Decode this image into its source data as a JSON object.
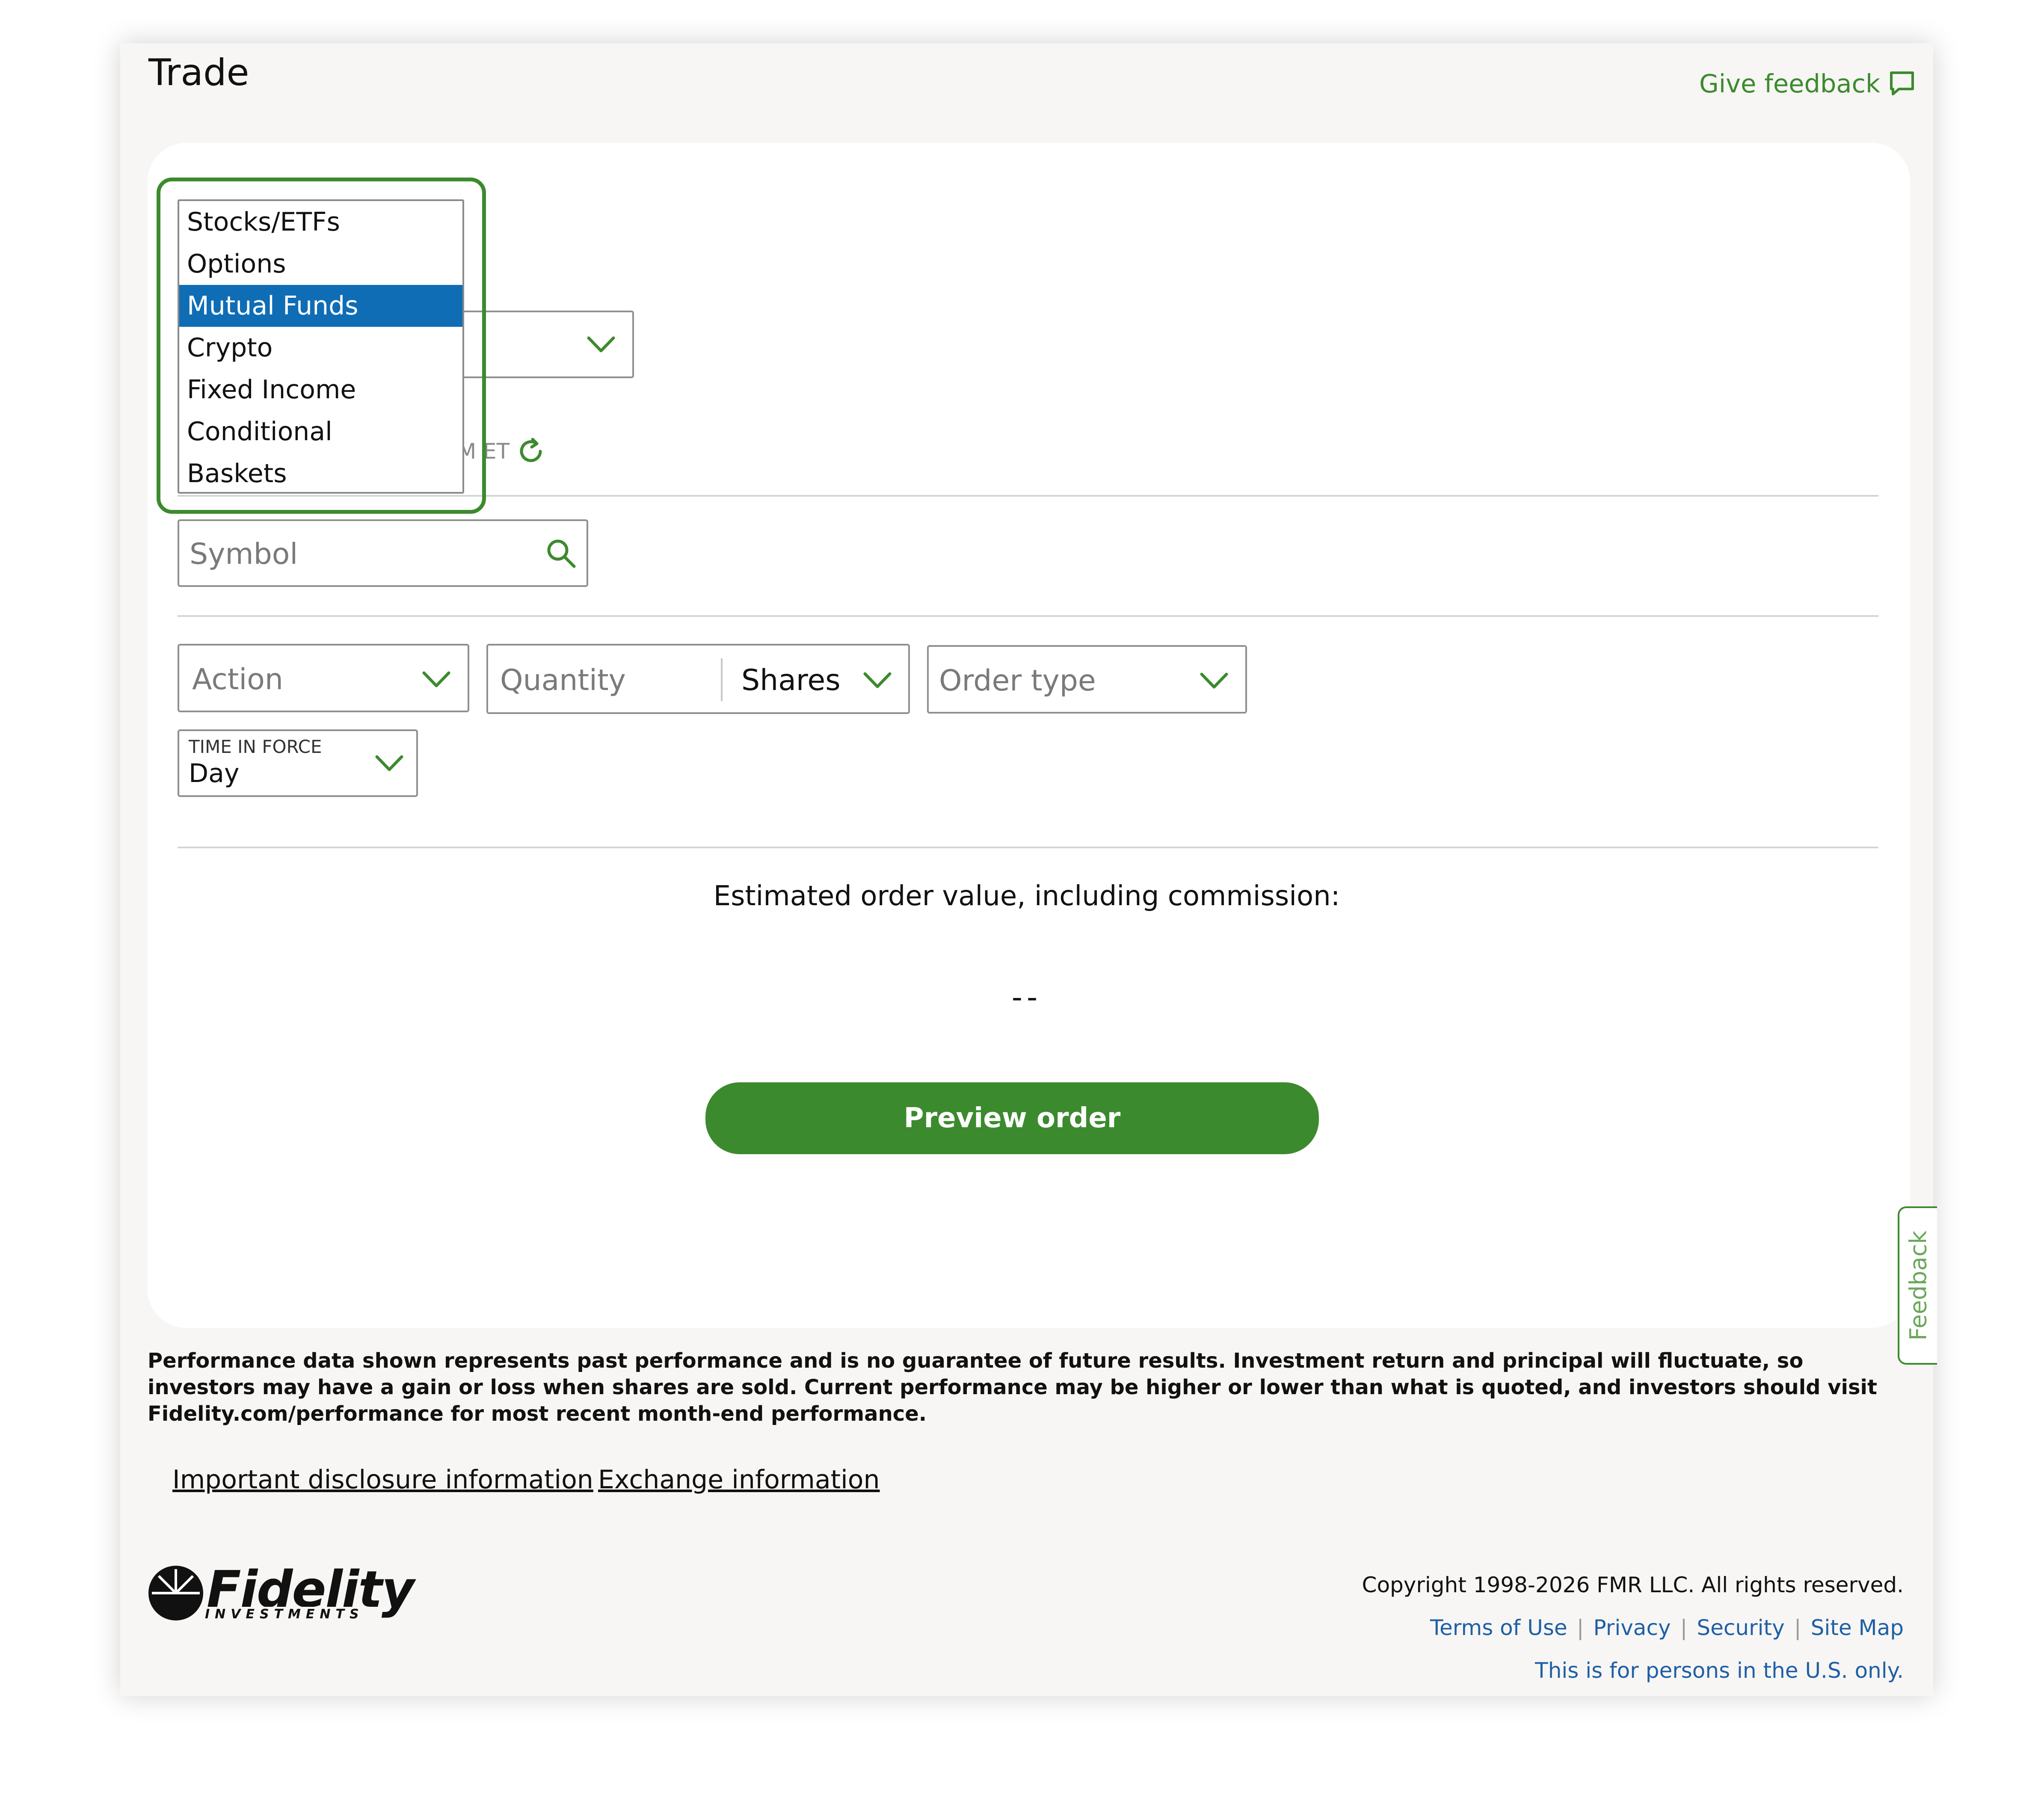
{
  "header": {
    "title": "Trade",
    "give_feedback_label": "Give feedback"
  },
  "trade_type_menu": {
    "options": [
      "Stocks/ETFs",
      "Options",
      "Mutual Funds",
      "Crypto",
      "Fixed Income",
      "Conditional",
      "Baskets"
    ],
    "selected": "Mutual Funds"
  },
  "account_select": {
    "partial_time_text": "M ET"
  },
  "symbol": {
    "placeholder": "Symbol"
  },
  "order": {
    "action_placeholder": "Action",
    "quantity_placeholder": "Quantity",
    "quantity_unit": "Shares",
    "order_type_placeholder": "Order type",
    "time_in_force_label": "TIME IN FORCE",
    "time_in_force_value": "Day"
  },
  "estimate": {
    "label": "Estimated order value, including commission:",
    "value": "--"
  },
  "preview_button_label": "Preview order",
  "feedback_tab_label": "Feedback",
  "disclaimer": {
    "text": "Performance data shown represents past performance and is no guarantee of future results. Investment return and principal will fluctuate, so investors may have a gain or loss when shares are sold. Current performance may be higher or lower than what is quoted, and investors should visit Fidelity.com/performance for most recent month-end performance."
  },
  "links": {
    "important_disclosure": "Important disclosure information",
    "exchange_info": "Exchange information"
  },
  "footer": {
    "logo_text": "Fidelity",
    "logo_subtext": "INVESTMENTS",
    "copyright": "Copyright 1998-2026 FMR LLC. All rights reserved.",
    "terms": "Terms of Use",
    "privacy": "Privacy",
    "security": "Security",
    "site_map": "Site Map",
    "us_only": "This is for persons in the U.S. only.",
    "separator": "|"
  },
  "colors": {
    "brand_green": "#3c8a2e",
    "selected_blue": "#0f6db5",
    "link_blue": "#1f5fa6"
  }
}
